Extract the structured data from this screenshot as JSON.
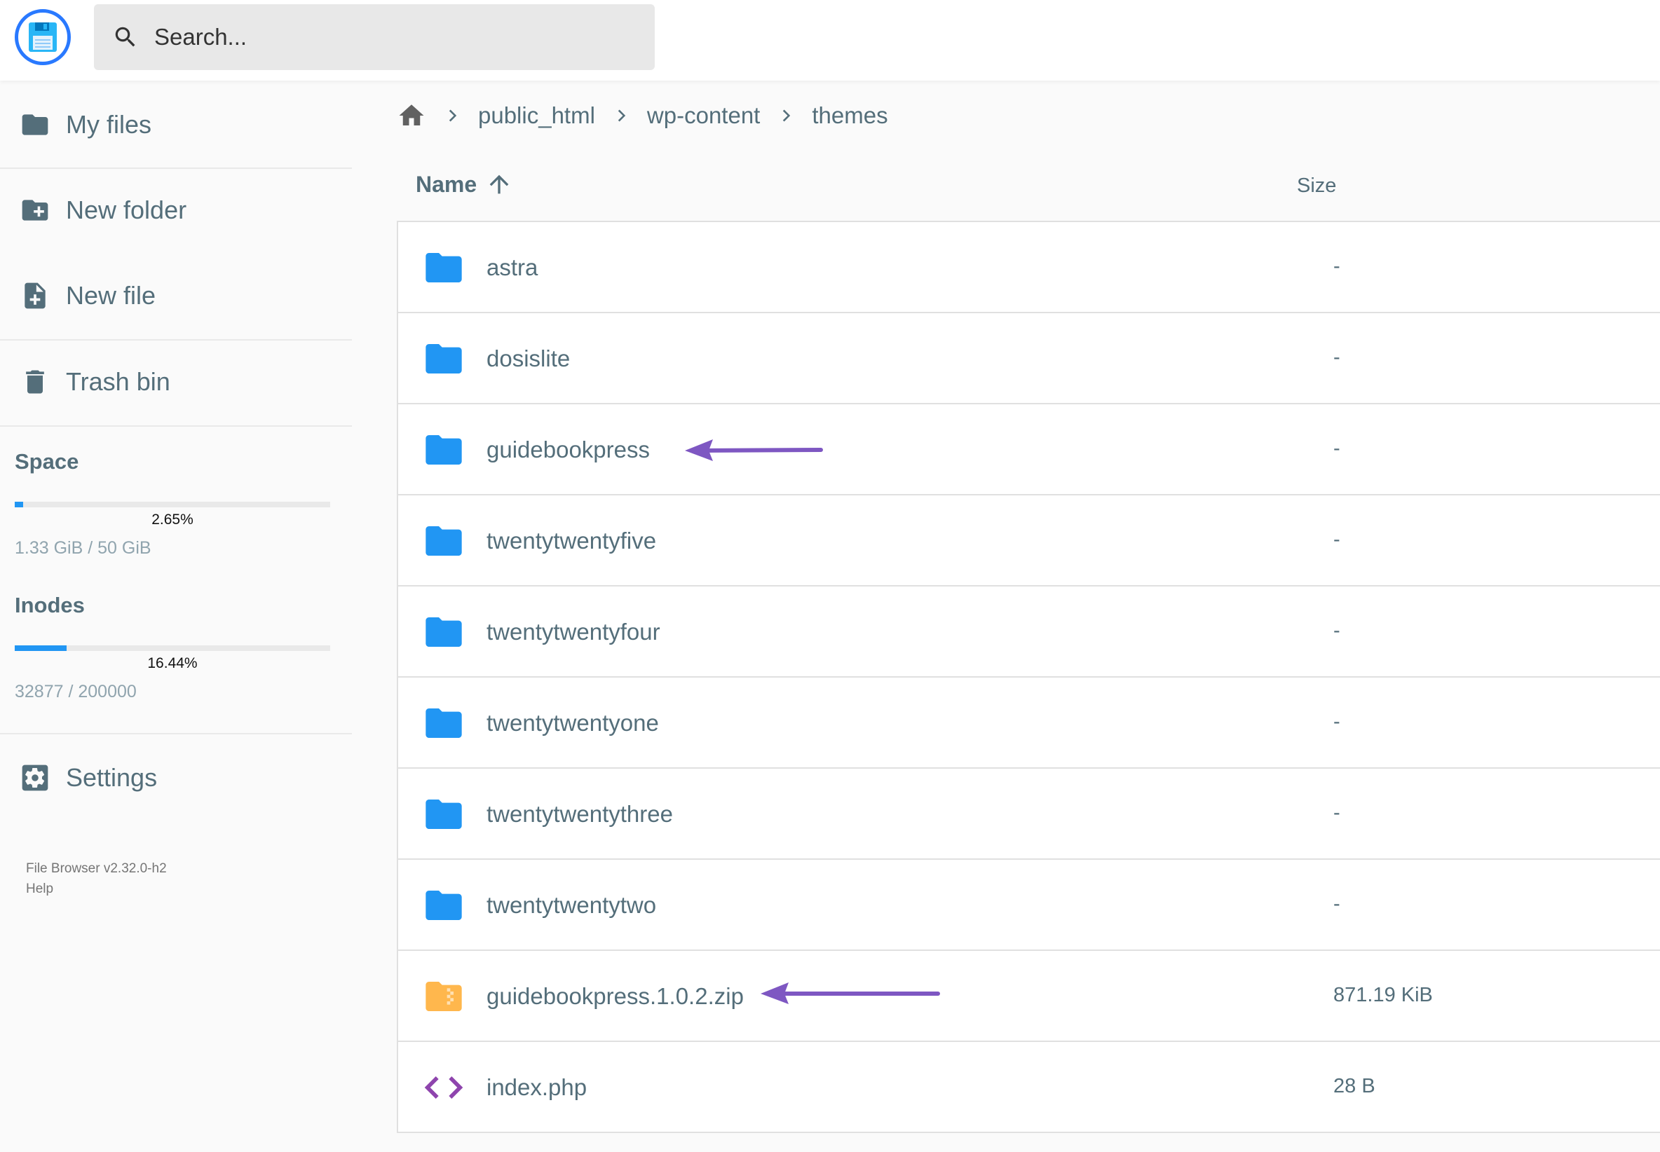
{
  "header": {
    "logo_icon": "floppy-disk-icon",
    "search_placeholder": "Search..."
  },
  "sidebar": {
    "items": [
      {
        "label": "My files",
        "icon": "folder-icon"
      },
      {
        "label": "New folder",
        "icon": "folder-plus-icon"
      },
      {
        "label": "New file",
        "icon": "file-plus-icon"
      },
      {
        "label": "Trash bin",
        "icon": "trash-icon"
      }
    ],
    "space": {
      "title": "Space",
      "percent_label": "2.65%",
      "percent": 2.65,
      "usage": "1.33 GiB / 50 GiB"
    },
    "inodes": {
      "title": "Inodes",
      "percent_label": "16.44%",
      "percent": 16.44,
      "usage": "32877 / 200000"
    },
    "settings": {
      "label": "Settings",
      "icon": "gear-icon"
    },
    "credits": {
      "version": "File Browser v2.32.0-h2",
      "help": "Help"
    }
  },
  "breadcrumb": {
    "home_icon": "home-icon",
    "parts": [
      "public_html",
      "wp-content",
      "themes"
    ]
  },
  "table": {
    "columns": {
      "name": "Name",
      "size": "Size"
    },
    "sort_icon": "arrow-up-icon",
    "rows": [
      {
        "name": "astra",
        "size": "-",
        "type": "folder"
      },
      {
        "name": "dosislite",
        "size": "-",
        "type": "folder"
      },
      {
        "name": "guidebookpress",
        "size": "-",
        "type": "folder"
      },
      {
        "name": "twentytwentyfive",
        "size": "-",
        "type": "folder"
      },
      {
        "name": "twentytwentyfour",
        "size": "-",
        "type": "folder"
      },
      {
        "name": "twentytwentyone",
        "size": "-",
        "type": "folder"
      },
      {
        "name": "twentytwentythree",
        "size": "-",
        "type": "folder"
      },
      {
        "name": "twentytwentytwo",
        "size": "-",
        "type": "folder"
      },
      {
        "name": "guidebookpress.1.0.2.zip",
        "size": "871.19 KiB",
        "type": "archive"
      },
      {
        "name": "index.php",
        "size": "28 B",
        "type": "code"
      }
    ]
  },
  "colors": {
    "accent": "#2196f3",
    "folder": "#2196f3",
    "archive": "#ffb74d",
    "code": "#8e44ad",
    "annotation_arrow": "#7e57c2",
    "text": "#546e7a"
  }
}
